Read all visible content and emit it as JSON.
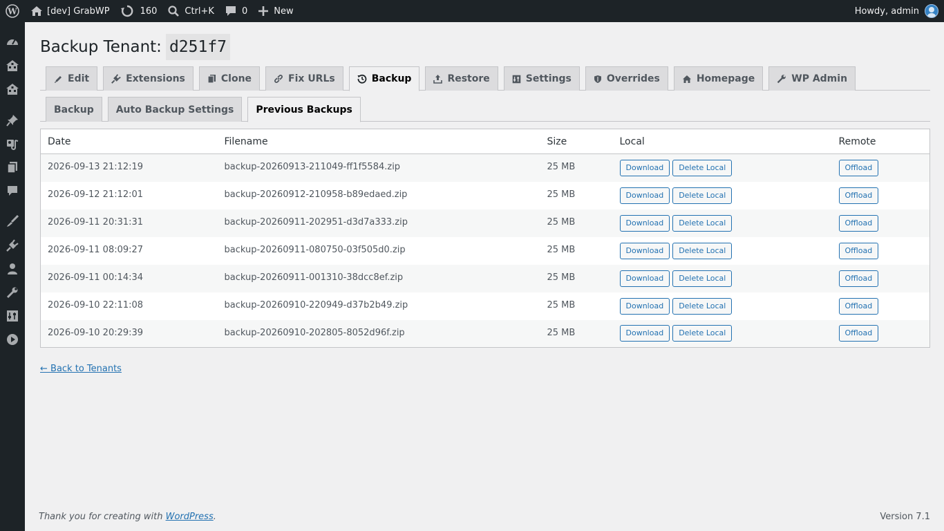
{
  "adminbar": {
    "site_name": "[dev] GrabWP",
    "updates_count": "160",
    "search_shortcut": "Ctrl+K",
    "comments_count": "0",
    "new_label": "New",
    "greeting": "Howdy, admin"
  },
  "sidebar_icons": [
    "dashboard-icon",
    "network-icon",
    "network-icon",
    "pin-icon",
    "media-icon",
    "pages-icon",
    "comments-icon",
    "appearance-icon",
    "plugins-icon",
    "users-icon",
    "tools-icon",
    "settings-icon",
    "play-icon"
  ],
  "page": {
    "title_prefix": "Backup Tenant:",
    "tenant_id": "d251f7"
  },
  "main_tabs": [
    {
      "label": "Edit",
      "icon": "edit-icon"
    },
    {
      "label": "Extensions",
      "icon": "plugin-icon"
    },
    {
      "label": "Clone",
      "icon": "copy-icon"
    },
    {
      "label": "Fix URLs",
      "icon": "link-icon"
    },
    {
      "label": "Backup",
      "icon": "backup-icon",
      "active": true
    },
    {
      "label": "Restore",
      "icon": "upload-icon"
    },
    {
      "label": "Settings",
      "icon": "settings-icon"
    },
    {
      "label": "Overrides",
      "icon": "shield-icon"
    },
    {
      "label": "Homepage",
      "icon": "home-icon"
    },
    {
      "label": "WP Admin",
      "icon": "admin-icon"
    }
  ],
  "sub_tabs": [
    {
      "label": "Backup"
    },
    {
      "label": "Auto Backup Settings"
    },
    {
      "label": "Previous Backups",
      "active": true
    }
  ],
  "table": {
    "headers": {
      "date": "Date",
      "filename": "Filename",
      "size": "Size",
      "local": "Local",
      "remote": "Remote"
    },
    "buttons": {
      "download": "Download",
      "delete_local": "Delete Local",
      "offload": "Offload"
    },
    "rows": [
      {
        "date": "2026-09-13 21:12:19",
        "filename": "backup-20260913-211049-ff1f5584.zip",
        "size": "25 MB"
      },
      {
        "date": "2026-09-12 21:12:01",
        "filename": "backup-20260912-210958-b89edaed.zip",
        "size": "25 MB"
      },
      {
        "date": "2026-09-11 20:31:31",
        "filename": "backup-20260911-202951-d3d7a333.zip",
        "size": "25 MB"
      },
      {
        "date": "2026-09-11 08:09:27",
        "filename": "backup-20260911-080750-03f505d0.zip",
        "size": "25 MB"
      },
      {
        "date": "2026-09-11 00:14:34",
        "filename": "backup-20260911-001310-38dcc8ef.zip",
        "size": "25 MB"
      },
      {
        "date": "2026-09-10 22:11:08",
        "filename": "backup-20260910-220949-d37b2b49.zip",
        "size": "25 MB"
      },
      {
        "date": "2026-09-10 20:29:39",
        "filename": "backup-20260910-202805-8052d96f.zip",
        "size": "25 MB"
      }
    ]
  },
  "back_link": "← Back to Tenants",
  "footer": {
    "thanks_prefix": "Thank you for creating with",
    "wordpress_link": "WordPress",
    "thanks_suffix": ".",
    "version": "Version 7.1"
  }
}
